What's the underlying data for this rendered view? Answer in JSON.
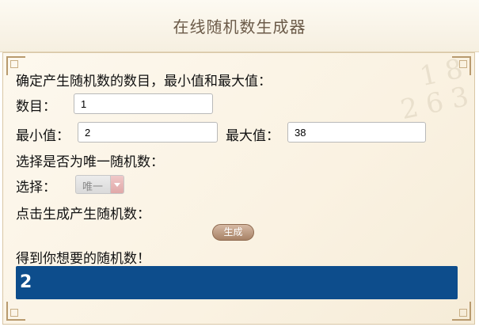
{
  "header": {
    "title": "在线随机数生成器"
  },
  "form": {
    "intro": "确定产生随机数的数目，最小值和最大值：",
    "count_label": "数目：",
    "count_value": "1",
    "min_label": "最小值：",
    "min_value": "2",
    "max_label": "最大值：",
    "max_value": "38",
    "unique_prompt": "选择是否为唯一随机数：",
    "select_label": "选择：",
    "select_value": "唯一",
    "generate_prompt": "点击生成产生随机数：",
    "generate_button": "生成",
    "result_label": "得到你想要的随机数！",
    "result_value": "2"
  },
  "colors": {
    "result_bg": "#0d4d8c",
    "title_color": "#6b5a48",
    "button_brown": "#a78266"
  }
}
